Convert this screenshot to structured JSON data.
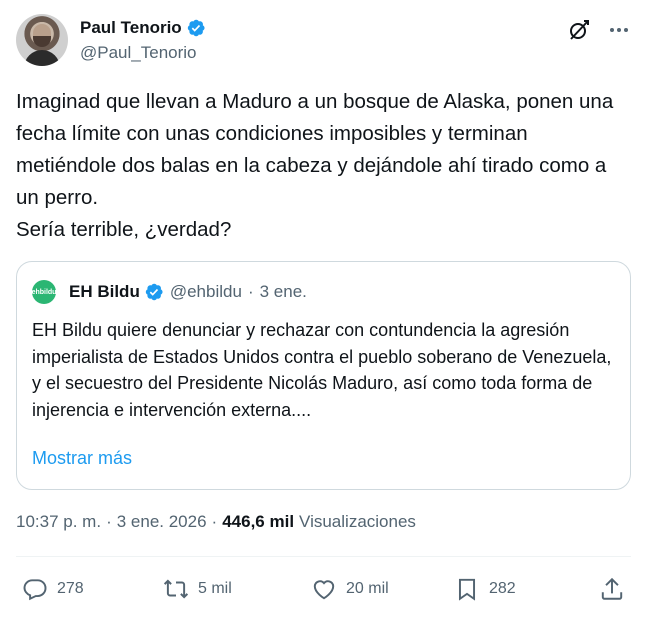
{
  "author": {
    "display_name": "Paul Tenorio",
    "handle": "@Paul_Tenorio"
  },
  "tweet": {
    "text": "Imaginad que llevan a Maduro a un bosque de Alaska, ponen una fecha límite con unas condiciones imposibles y terminan metiéndole dos balas en la cabeza y dejándole ahí tirado como a un perro.\nSería terrible, ¿verdad?"
  },
  "quote": {
    "logo_text": "ehbildu",
    "display_name": "EH Bildu",
    "handle": "@ehbildu",
    "separator": "·",
    "date": "3 ene.",
    "text": "EH Bildu quiere denunciar y rechazar con contundencia la agresión imperialista de Estados Unidos contra el pueblo soberano de Venezuela, y el secuestro del Presidente Nicolás Maduro, así como toda forma de injerencia e intervención externa....",
    "show_more": "Mostrar más"
  },
  "meta": {
    "time": "10:37 p. m.",
    "separator": "·",
    "date": "3 ene. 2026",
    "views_count": "446,6 mil",
    "views_label": "Visualizaciones"
  },
  "actions": {
    "replies": "278",
    "reposts": "5 mil",
    "likes": "20 mil",
    "bookmarks": "282"
  },
  "colors": {
    "verified": "#1d9bf0",
    "link": "#1d9bf0",
    "muted": "#536471",
    "bildu_green": "#2bb673"
  }
}
